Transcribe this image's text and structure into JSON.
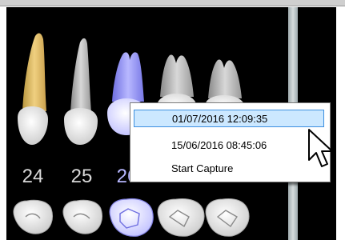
{
  "tooth_numbers": [
    "24",
    "25",
    "26"
  ],
  "context_menu": {
    "items": [
      {
        "label": "01/07/2016 12:09:35",
        "highlighted": true
      },
      {
        "label": "15/06/2016 08:45:06",
        "highlighted": false
      },
      {
        "label": "Start Capture",
        "highlighted": false
      }
    ]
  },
  "colors": {
    "panel_background": "#000000",
    "tooth_filled": "#e6c372",
    "tooth_selected": "#8c8cff",
    "tooth_normal": "#bdbdbd",
    "menu_highlight": "#cce8ff"
  }
}
